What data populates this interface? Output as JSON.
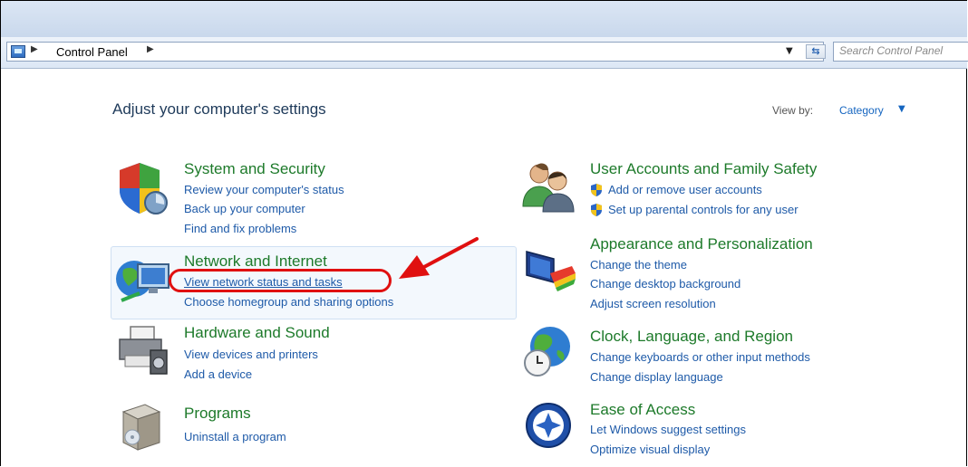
{
  "address_bar": {
    "breadcrumb": [
      "Control Panel"
    ],
    "search_placeholder": "Search Control Panel"
  },
  "header": {
    "title": "Adjust your computer's settings",
    "view_by_label": "View by:",
    "view_by_value": "Category"
  },
  "categories": {
    "system_security": {
      "title": "System and Security",
      "links": [
        "Review your computer's status",
        "Back up your computer",
        "Find and fix problems"
      ]
    },
    "network_internet": {
      "title": "Network and Internet",
      "links": [
        "View network status and tasks",
        "Choose homegroup and sharing options"
      ]
    },
    "hardware_sound": {
      "title": "Hardware and Sound",
      "links": [
        "View devices and printers",
        "Add a device"
      ]
    },
    "programs": {
      "title": "Programs",
      "links": [
        "Uninstall a program"
      ]
    },
    "user_accounts": {
      "title": "User Accounts and Family Safety",
      "links": [
        "Add or remove user accounts",
        "Set up parental controls for any user"
      ]
    },
    "appearance": {
      "title": "Appearance and Personalization",
      "links": [
        "Change the theme",
        "Change desktop background",
        "Adjust screen resolution"
      ]
    },
    "clock_language": {
      "title": "Clock, Language, and Region",
      "links": [
        "Change keyboards or other input methods",
        "Change display language"
      ]
    },
    "ease_access": {
      "title": "Ease of Access",
      "links": [
        "Let Windows suggest settings",
        "Optimize visual display"
      ]
    }
  },
  "annotation": {
    "color": "#e01010"
  }
}
